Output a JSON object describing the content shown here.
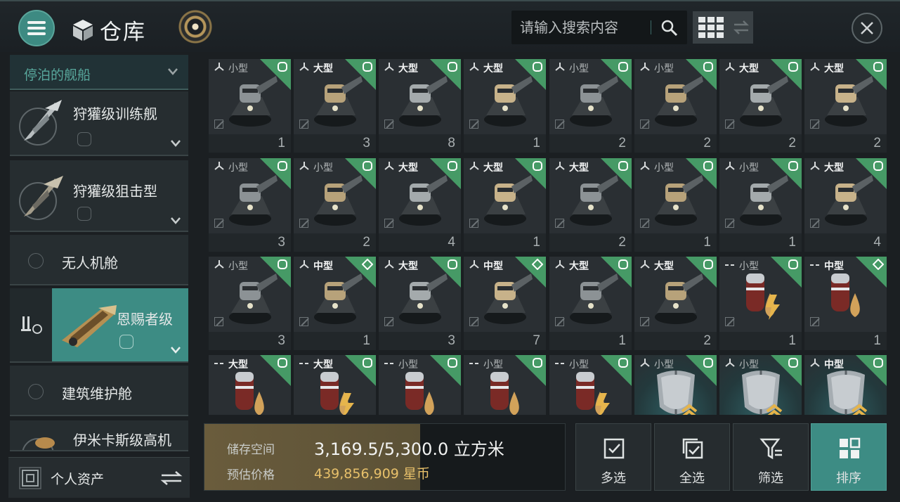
{
  "header": {
    "title": "仓库",
    "search_placeholder": "请输入搜索内容"
  },
  "sidebar": {
    "dock_label": "停泊的舰船",
    "ships": [
      {
        "name": "狩獾级训练舰"
      },
      {
        "name": "狩獾级狙击型"
      },
      {
        "name": "无人机舱"
      },
      {
        "name": "恩赐者级",
        "active": true
      },
      {
        "name": "建筑维护舱"
      },
      {
        "name": "伊米卡斯级高机"
      }
    ],
    "personal_assets": "个人资产"
  },
  "items": [
    {
      "type": "turret",
      "size": "小型",
      "bold": false,
      "qty": "1",
      "badge": "O"
    },
    {
      "type": "turret",
      "size": "大型",
      "bold": true,
      "qty": "3",
      "badge": "O"
    },
    {
      "type": "turret",
      "size": "大型",
      "bold": true,
      "qty": "8",
      "badge": "O"
    },
    {
      "type": "turret",
      "size": "大型",
      "bold": true,
      "qty": "1",
      "badge": "O"
    },
    {
      "type": "turret",
      "size": "小型",
      "bold": false,
      "qty": "2",
      "badge": "O"
    },
    {
      "type": "turret",
      "size": "小型",
      "bold": false,
      "qty": "2",
      "badge": "O"
    },
    {
      "type": "turret",
      "size": "大型",
      "bold": true,
      "qty": "2",
      "badge": "O"
    },
    {
      "type": "turret",
      "size": "大型",
      "bold": true,
      "qty": "2",
      "badge": "O"
    },
    {
      "type": "turret",
      "size": "小型",
      "bold": false,
      "qty": "3",
      "badge": "O"
    },
    {
      "type": "turret",
      "size": "小型",
      "bold": false,
      "qty": "2",
      "badge": "O"
    },
    {
      "type": "turret",
      "size": "大型",
      "bold": true,
      "qty": "4",
      "badge": "O"
    },
    {
      "type": "turret",
      "size": "大型",
      "bold": true,
      "qty": "1",
      "badge": "O"
    },
    {
      "type": "turret",
      "size": "大型",
      "bold": true,
      "qty": "2",
      "badge": "O"
    },
    {
      "type": "turret",
      "size": "小型",
      "bold": false,
      "qty": "1",
      "badge": "O"
    },
    {
      "type": "turret",
      "size": "小型",
      "bold": false,
      "qty": "1",
      "badge": "O"
    },
    {
      "type": "turret",
      "size": "大型",
      "bold": true,
      "qty": "4",
      "badge": "O"
    },
    {
      "type": "turret",
      "size": "小型",
      "bold": false,
      "qty": "3",
      "badge": "O"
    },
    {
      "type": "turret",
      "size": "中型",
      "bold": true,
      "qty": "1",
      "badge": "◇"
    },
    {
      "type": "turret",
      "size": "大型",
      "bold": true,
      "qty": "3",
      "badge": "O"
    },
    {
      "type": "turret",
      "size": "中型",
      "bold": true,
      "qty": "7",
      "badge": "◇"
    },
    {
      "type": "turret",
      "size": "大型",
      "bold": true,
      "qty": "1",
      "badge": "O"
    },
    {
      "type": "turret",
      "size": "大型",
      "bold": true,
      "qty": "2",
      "badge": "O"
    },
    {
      "type": "ammo",
      "size": "小型",
      "bold": false,
      "qty": "1",
      "badge": "O"
    },
    {
      "type": "ammo",
      "size": "中型",
      "bold": true,
      "qty": "1",
      "badge": "◇"
    },
    {
      "type": "ammo",
      "size": "大型",
      "bold": true,
      "qty": "",
      "badge": "O"
    },
    {
      "type": "ammo",
      "size": "大型",
      "bold": true,
      "qty": "",
      "badge": "O"
    },
    {
      "type": "ammo",
      "size": "小型",
      "bold": false,
      "qty": "",
      "badge": "O"
    },
    {
      "type": "ammo",
      "size": "小型",
      "bold": false,
      "qty": "",
      "badge": "O"
    },
    {
      "type": "ammo",
      "size": "小型",
      "bold": false,
      "qty": "",
      "badge": "O"
    },
    {
      "type": "drone",
      "size": "小型",
      "bold": false,
      "qty": "",
      "badge": "O"
    },
    {
      "type": "drone",
      "size": "小型",
      "bold": false,
      "qty": "",
      "badge": "O"
    },
    {
      "type": "drone",
      "size": "中型",
      "bold": true,
      "qty": "",
      "badge": "O"
    }
  ],
  "storage": {
    "space_label": "储存空间",
    "space_value": "3,169.5/5,300.0 立方米",
    "space_fraction": 0.598,
    "price_label": "预估价格",
    "price_value": "439,856,909 星币"
  },
  "actions": {
    "multi_select": "多选",
    "select_all": "全选",
    "filter": "筛选",
    "sort": "排序"
  },
  "colors": {
    "accent": "#3d8c84",
    "badge_green": "#469a66",
    "price_gold": "#e7c06a"
  }
}
